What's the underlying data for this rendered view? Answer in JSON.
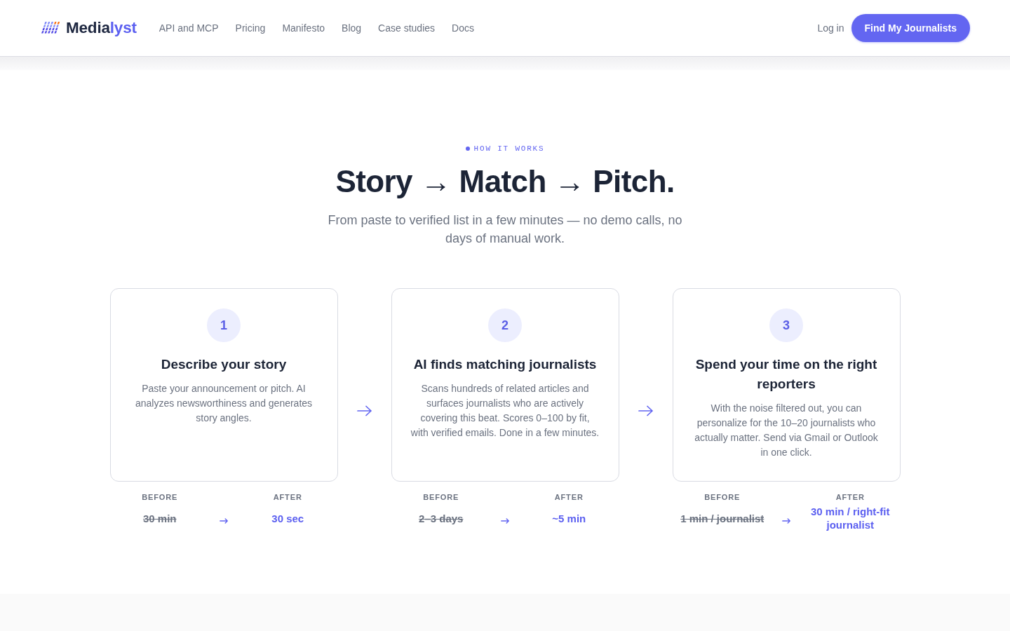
{
  "header": {
    "brand": {
      "name": "Media",
      "name_accent": "lyst"
    },
    "nav": [
      "API and MCP",
      "Pricing",
      "Manifesto",
      "Blog",
      "Case studies",
      "Docs"
    ],
    "login": "Log in",
    "cta": "Find My Journalists"
  },
  "section": {
    "eyebrow": "HOW IT WORKS",
    "heading": "Story → Match → Pitch.",
    "subtitle": "From paste to verified list in a few minutes — no demo calls, no days of manual work.",
    "steps": [
      {
        "number": "1",
        "title": "Describe your story",
        "description": "Paste your announcement or pitch. AI analyzes newsworthiness and generates story angles.",
        "before_label": "BEFORE",
        "before": "30 min",
        "after_label": "AFTER",
        "after": "30 sec"
      },
      {
        "number": "2",
        "title": "AI finds matching journalists",
        "description": "Scans hundreds of related articles and surfaces journalists who are actively covering this beat. Scores 0–100 by fit, with verified emails. Done in a few minutes.",
        "before_label": "BEFORE",
        "before": "2–3 days",
        "after_label": "AFTER",
        "after": "~5 min"
      },
      {
        "number": "3",
        "title": "Spend your time on the right reporters",
        "description": "With the noise filtered out, you can personalize for the 10–20 journalists who actually matter. Send via Gmail or Outlook in one click.",
        "before_label": "BEFORE",
        "before": "1 min / journalist",
        "after_label": "AFTER",
        "after": "30 min / right-fit journalist"
      }
    ]
  }
}
